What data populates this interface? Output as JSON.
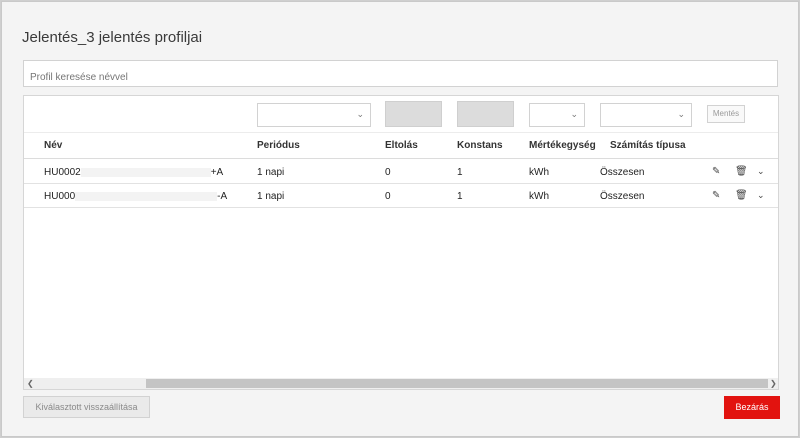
{
  "dialog": {
    "title": "Jelentés_3 jelentés profiljai",
    "search_placeholder": "Profil keresése névvel"
  },
  "filters": {
    "save_label": "Mentés"
  },
  "table": {
    "headers": [
      "Név",
      "Periódus",
      "Eltolás",
      "Konstans",
      "Mértékegység",
      "Számítás típusa"
    ],
    "rows": [
      {
        "name_prefix": "HU0002",
        "name_suffix": "+A",
        "period": "1 napi",
        "offset": "0",
        "constant": "1",
        "unit": "kWh",
        "calc_type": "Összesen"
      },
      {
        "name_prefix": "HU000",
        "name_suffix": "-A",
        "period": "1 napi",
        "offset": "0",
        "constant": "1",
        "unit": "kWh",
        "calc_type": "Összesen"
      }
    ]
  },
  "footer": {
    "reset_label": "Kiválasztott visszaállítása",
    "close_label": "Bezárás"
  },
  "colors": {
    "primary_button": "#e2130f"
  }
}
